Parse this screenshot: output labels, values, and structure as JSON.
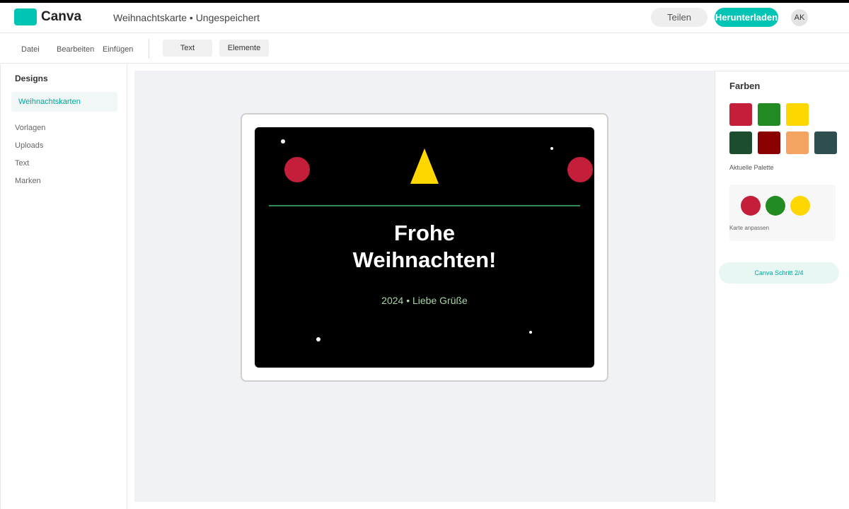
{
  "header": {
    "logo_text": "Canva",
    "doc_title": "Weihnachtskarte • Ungespeichert",
    "share_label": "Teilen",
    "download_label": "Herunterladen",
    "avatar_initials": "AK"
  },
  "toolbar": {
    "menu": [
      "Datei",
      "Bearbeiten",
      "Einfügen"
    ],
    "text_button": "Text",
    "elements_button": "Elemente"
  },
  "sidebar": {
    "title": "Designs",
    "active_item": "Weihnachtskarten",
    "items": [
      "Vorlagen",
      "Uploads",
      "Text",
      "Marken"
    ]
  },
  "card": {
    "headline_line1": "Frohe",
    "headline_line2": "Weihnachten!",
    "subline": "2024 • Liebe Grüße",
    "background_color": "#000000",
    "ornament_color": "#c41e3a",
    "tree_color": "#ffd700",
    "divider_color": "#2e8b57",
    "subline_color": "#a8d5a8"
  },
  "right_panel": {
    "title": "Farben",
    "swatches": [
      "#c41e3a",
      "#228b22",
      "#ffd700",
      "#1b4d2e",
      "#8b0000",
      "#f4a460",
      "#2f4f4f"
    ],
    "palette_label": "Aktuelle Palette",
    "palette_colors": [
      "#c41e3a",
      "#228b22",
      "#ffd700"
    ],
    "palette_caption": "Karte anpassen",
    "step_label": "Canva Schritt 2/4"
  },
  "theme": {
    "accent": "#00c4b4"
  }
}
